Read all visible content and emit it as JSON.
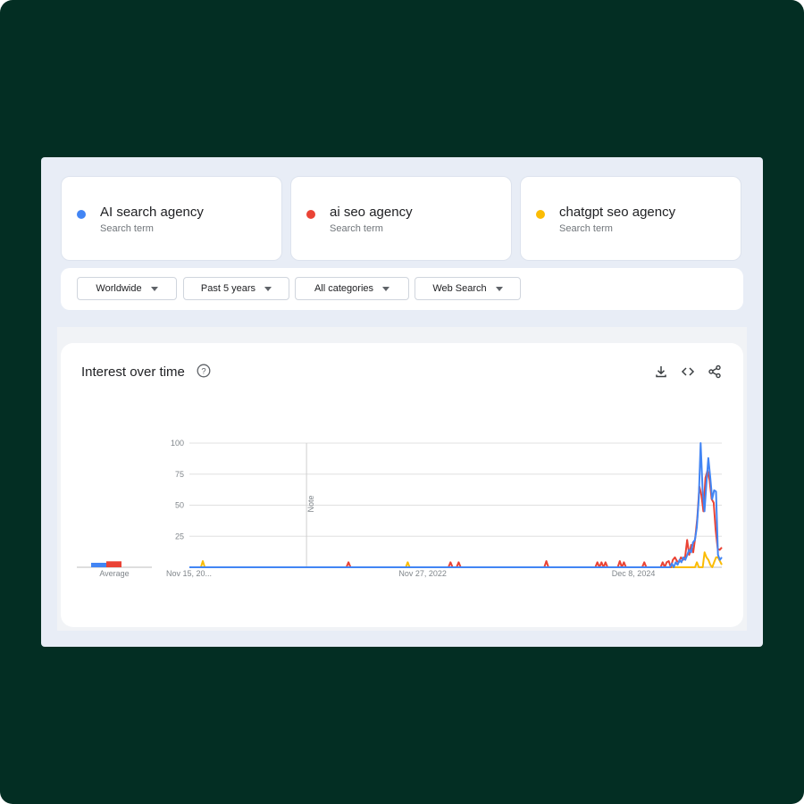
{
  "terms": [
    {
      "name": "AI search agency",
      "sub": "Search term",
      "color": "#4285f4"
    },
    {
      "name": "ai seo agency",
      "sub": "Search term",
      "color": "#ea4335"
    },
    {
      "name": "chatgpt seo agency",
      "sub": "Search term",
      "color": "#fbbc04"
    }
  ],
  "filters": {
    "region": "Worldwide",
    "time": "Past 5 years",
    "category": "All categories",
    "type": "Web Search"
  },
  "chart_card": {
    "title": "Interest over time",
    "help_icon": "help-circle-icon",
    "download_icon": "download-icon",
    "embed_icon": "code-icon",
    "share_icon": "share-icon"
  },
  "chart_data": {
    "type": "line",
    "title": "Interest over time",
    "ylim": [
      0,
      100
    ],
    "yticks": [
      25,
      50,
      75,
      100
    ],
    "x_tick_labels": [
      "Nov 15, 20...",
      "Nov 27, 2022",
      "Dec 8, 2024"
    ],
    "x_tick_fractions": [
      0.0,
      0.4,
      0.8
    ],
    "note_label": "Note",
    "note_fraction": 0.22,
    "average_label": "Average",
    "average_values": [
      3,
      4,
      0
    ],
    "grid": true,
    "series": [
      {
        "name": "AI search agency",
        "color": "#4285f4",
        "values": [
          0,
          0,
          0,
          0,
          0,
          0,
          0,
          0,
          0,
          0,
          0,
          0,
          0,
          0,
          0,
          0,
          0,
          0,
          0,
          0,
          0,
          0,
          0,
          0,
          0,
          0,
          0,
          0,
          0,
          0,
          0,
          0,
          0,
          0,
          0,
          0,
          0,
          0,
          0,
          0,
          0,
          0,
          0,
          0,
          0,
          0,
          0,
          0,
          0,
          0,
          0,
          0,
          0,
          0,
          0,
          0,
          0,
          0,
          0,
          0,
          0,
          0,
          0,
          0,
          0,
          0,
          0,
          0,
          0,
          0,
          0,
          0,
          0,
          0,
          0,
          0,
          0,
          0,
          0,
          0,
          0,
          0,
          0,
          0,
          0,
          0,
          0,
          0,
          0,
          0,
          0,
          0,
          0,
          0,
          0,
          0,
          0,
          0,
          0,
          0,
          0,
          0,
          0,
          0,
          0,
          0,
          0,
          0,
          0,
          0,
          0,
          0,
          0,
          0,
          0,
          0,
          0,
          0,
          0,
          0,
          0,
          0,
          0,
          0,
          0,
          0,
          0,
          0,
          0,
          0,
          0,
          0,
          0,
          0,
          0,
          0,
          0,
          0,
          0,
          0,
          0,
          0,
          0,
          0,
          0,
          0,
          0,
          0,
          0,
          0,
          0,
          0,
          0,
          0,
          0,
          0,
          0,
          0,
          0,
          0,
          0,
          0,
          0,
          0,
          0,
          0,
          0,
          0,
          0,
          0,
          0,
          0,
          0,
          0,
          0,
          0,
          0,
          0,
          0,
          0,
          0,
          0,
          0,
          0,
          0,
          0,
          0,
          0,
          0,
          0,
          0,
          0,
          0,
          0,
          0,
          0,
          0,
          0,
          0,
          0,
          0,
          0,
          0,
          0,
          0,
          0,
          0,
          0,
          0,
          0,
          0,
          0,
          0,
          0,
          0,
          0,
          0,
          0,
          0,
          0,
          0,
          0,
          0,
          0,
          0,
          0,
          0,
          0,
          0,
          0,
          0,
          0,
          0,
          0,
          0,
          0,
          0,
          0,
          0,
          0,
          0,
          0,
          0,
          0,
          0,
          0,
          0,
          0,
          0,
          0,
          0,
          3,
          0,
          4,
          2,
          6,
          4,
          8,
          6,
          10,
          14,
          12,
          20,
          22,
          32,
          55,
          100,
          62,
          45,
          68,
          88,
          72,
          55,
          62,
          61,
          10,
          6,
          8
        ]
      },
      {
        "name": "ai seo agency",
        "color": "#ea4335",
        "values": [
          0,
          0,
          0,
          0,
          0,
          0,
          0,
          0,
          0,
          0,
          0,
          0,
          0,
          0,
          0,
          0,
          0,
          0,
          0,
          0,
          0,
          0,
          0,
          0,
          0,
          0,
          0,
          0,
          0,
          0,
          0,
          0,
          0,
          0,
          0,
          0,
          0,
          0,
          0,
          0,
          0,
          0,
          0,
          0,
          0,
          0,
          0,
          0,
          0,
          0,
          0,
          0,
          0,
          0,
          0,
          0,
          0,
          0,
          0,
          0,
          0,
          0,
          0,
          0,
          0,
          0,
          0,
          0,
          0,
          0,
          0,
          0,
          0,
          0,
          0,
          0,
          0,
          0,
          4,
          0,
          0,
          0,
          0,
          0,
          0,
          0,
          0,
          0,
          0,
          0,
          0,
          0,
          0,
          0,
          0,
          0,
          0,
          0,
          0,
          0,
          0,
          0,
          0,
          0,
          0,
          0,
          0,
          0,
          0,
          0,
          0,
          0,
          0,
          0,
          0,
          0,
          0,
          0,
          0,
          0,
          0,
          0,
          0,
          0,
          0,
          0,
          0,
          0,
          4,
          0,
          0,
          0,
          4,
          0,
          0,
          0,
          0,
          0,
          0,
          0,
          0,
          0,
          0,
          0,
          0,
          0,
          0,
          0,
          0,
          0,
          0,
          0,
          0,
          0,
          0,
          0,
          0,
          0,
          0,
          0,
          0,
          0,
          0,
          0,
          0,
          0,
          0,
          0,
          0,
          0,
          0,
          0,
          0,
          0,
          0,
          5,
          0,
          0,
          0,
          0,
          0,
          0,
          0,
          0,
          0,
          0,
          0,
          0,
          0,
          0,
          0,
          0,
          0,
          0,
          0,
          0,
          0,
          0,
          0,
          0,
          4,
          0,
          4,
          0,
          4,
          0,
          0,
          0,
          0,
          0,
          0,
          5,
          0,
          4,
          0,
          0,
          0,
          0,
          0,
          0,
          0,
          0,
          0,
          4,
          0,
          0,
          0,
          0,
          0,
          0,
          0,
          0,
          4,
          0,
          4,
          5,
          0,
          6,
          8,
          5,
          4,
          8,
          6,
          8,
          22,
          10,
          18,
          12,
          24,
          40,
          65,
          58,
          45,
          72,
          78,
          70,
          55,
          52,
          30,
          15,
          14,
          16
        ]
      },
      {
        "name": "chatgpt seo agency",
        "color": "#fbbc04",
        "values": [
          0,
          0,
          0,
          0,
          0,
          0,
          0,
          5,
          0,
          0,
          0,
          0,
          0,
          0,
          0,
          0,
          0,
          0,
          0,
          0,
          0,
          0,
          0,
          0,
          0,
          0,
          0,
          0,
          0,
          0,
          0,
          0,
          0,
          0,
          0,
          0,
          0,
          0,
          0,
          0,
          0,
          0,
          0,
          0,
          0,
          0,
          0,
          0,
          0,
          0,
          0,
          0,
          0,
          0,
          0,
          0,
          0,
          0,
          0,
          0,
          0,
          0,
          0,
          0,
          0,
          0,
          0,
          0,
          0,
          0,
          0,
          0,
          0,
          0,
          0,
          0,
          0,
          0,
          0,
          0,
          0,
          0,
          0,
          0,
          0,
          0,
          0,
          0,
          0,
          0,
          0,
          0,
          0,
          0,
          0,
          0,
          0,
          0,
          0,
          0,
          0,
          0,
          0,
          0,
          0,
          0,
          0,
          0,
          0,
          0,
          0,
          0,
          0,
          0,
          4,
          0,
          0,
          0,
          0,
          0,
          0,
          0,
          0,
          0,
          0,
          0,
          0,
          0,
          0,
          0,
          0,
          0,
          0,
          0,
          0,
          0,
          0,
          0,
          0,
          0,
          0,
          0,
          0,
          0,
          0,
          0,
          0,
          0,
          0,
          0,
          0,
          0,
          0,
          0,
          0,
          0,
          0,
          0,
          0,
          0,
          0,
          0,
          0,
          0,
          0,
          0,
          0,
          0,
          0,
          0,
          0,
          0,
          0,
          0,
          0,
          0,
          0,
          0,
          0,
          0,
          0,
          0,
          0,
          0,
          0,
          0,
          0,
          0,
          0,
          0,
          0,
          0,
          0,
          0,
          0,
          0,
          0,
          0,
          0,
          0,
          0,
          0,
          0,
          0,
          0,
          0,
          0,
          0,
          0,
          0,
          0,
          0,
          0,
          0,
          0,
          0,
          0,
          0,
          0,
          0,
          0,
          0,
          0,
          0,
          0,
          0,
          0,
          0,
          0,
          0,
          0,
          0,
          0,
          0,
          0,
          0,
          0,
          0,
          0,
          0,
          0,
          0,
          0,
          0,
          0,
          0,
          0,
          0,
          0,
          0,
          0,
          0,
          0,
          0,
          0,
          0,
          0,
          0,
          0,
          0,
          0,
          0,
          0,
          0,
          0,
          4,
          0,
          0,
          0,
          12,
          8,
          6,
          2,
          0,
          4,
          8,
          8,
          5,
          2
        ]
      }
    ]
  }
}
